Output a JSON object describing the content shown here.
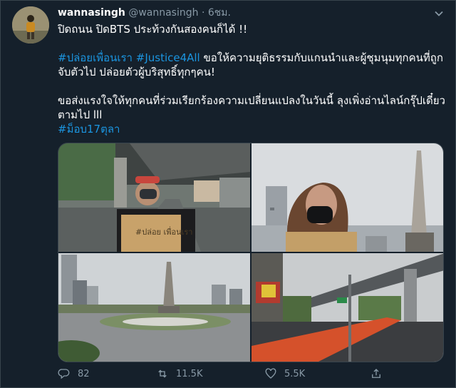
{
  "tweet": {
    "display_name": "wannasingh",
    "handle": "@wannasingh",
    "separator": "·",
    "time": "6ชม.",
    "line1": "ปิดถนน ปิดBTS ประท้วงกันสองคนก็ได้ !!",
    "tag1": "#ปล่อยเพื่อนเรา",
    "tag2": "#Justice4All",
    "line2_rest": " ขอให้ความยุติธรรมกับแกนนำและผู้ชุมนุมทุกคนที่ถูกจับตัวไป ปล่อยตัวผู้บริสุทธิ์ทุกๆคน!",
    "line3": "ขอส่งแรงใจให้ทุกคนที่ร่วมเรียกร้องความเปลี่ยนแปลงในวันนี้ ลุงเพิ่งอ่านไลน์กรุ๊ปเดี๋ยวตามไป lll",
    "tag3": "#ม็อบ17ตุลา"
  },
  "media": {
    "sign_text": "#ปล่อย เพื่อนเรา"
  },
  "actions": {
    "replies": "82",
    "retweets": "11.5K",
    "likes": "5.5K"
  },
  "colors": {
    "background": "#15202b",
    "accent": "#1b95e0",
    "muted": "#8899a6",
    "border": "#38444d"
  }
}
